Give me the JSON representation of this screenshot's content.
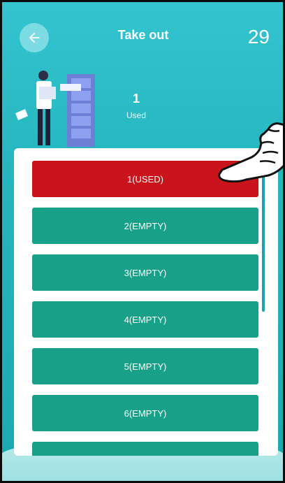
{
  "header": {
    "title": "Take out",
    "count": "29"
  },
  "summary": {
    "used_count": "1",
    "used_label": "Used"
  },
  "slots": [
    {
      "label": "1(USED)",
      "status": "used"
    },
    {
      "label": "2(EMPTY)",
      "status": "empty"
    },
    {
      "label": "3(EMPTY)",
      "status": "empty"
    },
    {
      "label": "4(EMPTY)",
      "status": "empty"
    },
    {
      "label": "5(EMPTY)",
      "status": "empty"
    },
    {
      "label": "6(EMPTY)",
      "status": "empty"
    },
    {
      "label": "",
      "status": "empty"
    }
  ],
  "colors": {
    "used": "#c8141a",
    "empty": "#19a088",
    "background": "#25b6c0"
  },
  "icons": {
    "back": "arrow-left-icon",
    "illustration": "person-filing-cabinet-illustration",
    "pointer": "pointing-hand-icon"
  }
}
